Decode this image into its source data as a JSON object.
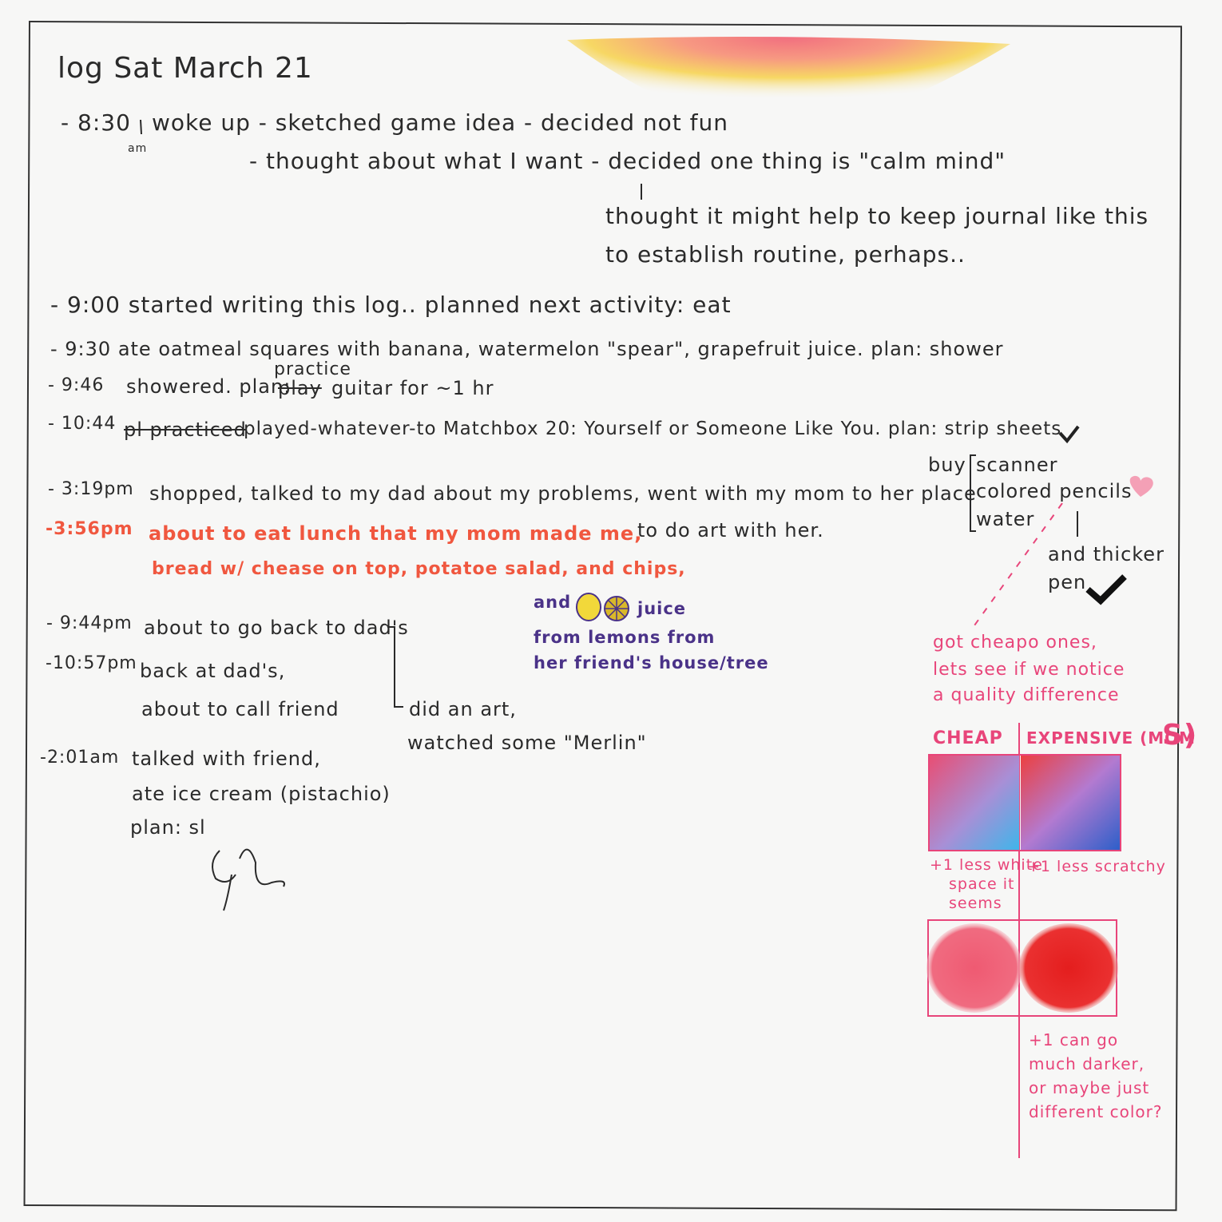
{
  "title": "log  Sat March 21",
  "entries": {
    "e830_time": "- 8:30",
    "e830_ampm": "am",
    "e830_a": "woke up  - sketched game idea - decided not fun",
    "e830_b": "- thought about what I want - decided one thing is \"calm mind\"",
    "e830_c": "thought it might help to keep journal like this",
    "e830_d": "to establish routine, perhaps..",
    "e900": "- 9:00  started writing this log.. planned next activity: eat",
    "e930": "- 9:30  ate oatmeal squares with banana, watermelon \"spear\", grapefruit juice. plan: shower",
    "e946_time": "- 9:46",
    "e946_a": "showered. plan:",
    "e946_strike": "play",
    "e946_b": "guitar for ~1 hr",
    "e946_insert": "practice",
    "e1044_time": "- 10:44",
    "e1044_strike": "pl practiced",
    "e1044_a": "played-whatever-to Matchbox 20: Yourself or Someone Like You. plan: strip sheets",
    "buy_label": "buy",
    "buy_items": [
      "scanner",
      "colored pencils",
      "water"
    ],
    "buy_extra_1": "and thicker",
    "buy_extra_2": "pen",
    "e319_time": "- 3:19pm",
    "e319_a": "shopped, talked to my dad about my problems, went with my mom to her place",
    "e319_b": "to do art with her.",
    "e356_time": "-3:56pm",
    "e356_a": "about to eat lunch that my mom made me,",
    "e356_b": "bread w/ chease on top, potatoe salad, and chips,",
    "juice_and": "and",
    "juice_word": "juice",
    "juice_b": "from lemons from",
    "juice_c": "her friend's house/tree",
    "e944_time": "- 9:44pm",
    "e944_a": "about to go back to dad's",
    "e1057_time": "-10:57pm",
    "e1057_a": "back at dad's,",
    "e1057_b": "about to call friend",
    "art_a": "did an art,",
    "art_b": "watched some \"Merlin\"",
    "e201_time": "-2:01am",
    "e201_a": "talked with friend,",
    "e201_b": "ate ice cream (pistachio)",
    "e201_c": "plan: sl"
  },
  "pencil_notes": {
    "note_1": "got cheapo ones,",
    "note_2": "lets see if we notice",
    "note_3": "a quality difference",
    "cheap_label": "CHEAP",
    "expensive_label": "EXPENSIVE (MOM",
    "expensive_paren": "S)",
    "cheap_note_1": "+1 less white",
    "cheap_note_2": "space it",
    "cheap_note_3": "seems",
    "expensive_note_1": "+1 less scratchy",
    "dark_note_1": "+1 can go",
    "dark_note_2": "much darker,",
    "dark_note_3": "or maybe just",
    "dark_note_4": "different color?"
  },
  "colors": {
    "ink": "#2a2a2a",
    "red_ink": "#f0573f",
    "purple_ink": "#4a3288",
    "pink_ink": "#e8457a"
  }
}
